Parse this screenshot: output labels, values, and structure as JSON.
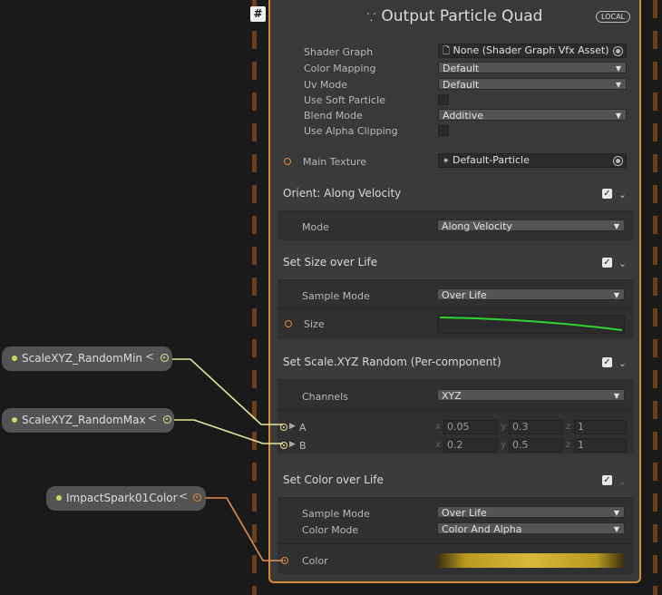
{
  "node": {
    "title": "Output Particle Quad",
    "badge": "LOCAL",
    "hash_label": "#",
    "title_icon": "particles-icon",
    "properties": [
      {
        "label": "Shader Graph",
        "kind": "object",
        "value": "None (Shader Graph Vfx Asset)"
      },
      {
        "label": "Color Mapping",
        "kind": "dropdown",
        "value": "Default"
      },
      {
        "label": "Uv Mode",
        "kind": "dropdown",
        "value": "Default"
      },
      {
        "label": "Use Soft Particle",
        "kind": "toggle"
      },
      {
        "label": "Blend Mode",
        "kind": "dropdown",
        "value": "Additive"
      },
      {
        "label": "Use Alpha Clipping",
        "kind": "toggle"
      }
    ],
    "main_texture": {
      "label": "Main Texture",
      "value": "Default-Particle"
    }
  },
  "blocks": {
    "orient": {
      "title": "Orient: Along Velocity",
      "mode_label": "Mode",
      "mode_value": "Along Velocity"
    },
    "size": {
      "title": "Set Size over Life",
      "sample_label": "Sample Mode",
      "sample_value": "Over Life",
      "size_label": "Size"
    },
    "scale": {
      "title": "Set Scale.XYZ Random (Per-component)",
      "channels_label": "Channels",
      "channels_value": "XYZ",
      "a": {
        "label": "A",
        "x": "0.05",
        "y": "0.3",
        "z": "1"
      },
      "b": {
        "label": "B",
        "x": "0.2",
        "y": "0.5",
        "z": "1"
      },
      "axis_x": "x",
      "axis_y": "y",
      "axis_z": "z"
    },
    "color": {
      "title": "Set Color over Life",
      "sample_label": "Sample Mode",
      "sample_value": "Over Life",
      "mode_label": "Color Mode",
      "mode_value": "Color And Alpha",
      "color_label": "Color"
    }
  },
  "parameters": [
    {
      "name": "ScaleXYZ_RandomMin",
      "chevron": "<"
    },
    {
      "name": "ScaleXYZ_RandomMax",
      "chevron": "<"
    },
    {
      "name": "ImpactSpark01Color",
      "chevron": "<"
    }
  ],
  "colors": {
    "node_border": "#d58a3a",
    "port_orange": "#e08a3a",
    "port_yellow": "#e4e48c",
    "curve_green": "#2fd42f",
    "wire_yellow": "#e6e69a",
    "wire_orange": "#e09050"
  }
}
